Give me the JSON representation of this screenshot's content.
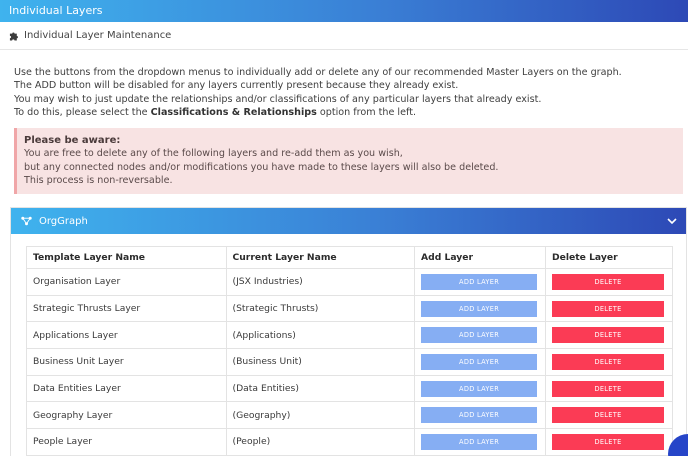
{
  "topbar": {
    "title": "Individual Layers"
  },
  "subheader": {
    "title": "Individual Layer Maintenance",
    "icon": "puzzle-icon"
  },
  "intro": {
    "line1": "Use the buttons from the dropdown menus to individually add or delete any of our recommended Master Layers on the graph.",
    "line2": "The ADD button will be disabled for any layers currently present because they already exist.",
    "line3": "You may wish to just update the relationships and/or classifications of any particular layers that already exist.",
    "line4_pre": "To do this, please select the ",
    "line4_bold": "Classifications & Relationships",
    "line4_post": " option from the left."
  },
  "alert": {
    "title": "Please be aware:",
    "line1": "You are free to delete any of the following layers and re-add them as you wish,",
    "line2": "but any connected nodes and/or modifications you have made to these layers will also be deleted.",
    "line3": "This process is non-reversable."
  },
  "card": {
    "title": "OrgGraph",
    "icon": "graph-icon",
    "toggle_icon": "chevron-down-icon"
  },
  "table": {
    "headers": [
      "Template Layer Name",
      "Current Layer Name",
      "Add Layer",
      "Delete Layer"
    ],
    "add_label": "ADD LAYER",
    "delete_label": "DELETE",
    "rows": [
      {
        "template": "Organisation Layer",
        "current": "(JSX Industries)"
      },
      {
        "template": "Strategic Thrusts Layer",
        "current": "(Strategic Thrusts)"
      },
      {
        "template": "Applications Layer",
        "current": "(Applications)"
      },
      {
        "template": "Business Unit Layer",
        "current": "(Business Unit)"
      },
      {
        "template": "Data Entities Layer",
        "current": "(Data Entities)"
      },
      {
        "template": "Geography Layer",
        "current": "(Geography)"
      },
      {
        "template": "People Layer",
        "current": "(People)"
      }
    ]
  },
  "colors": {
    "accent_start": "#3fb3ee",
    "accent_end": "#2d49b6",
    "add_button": "#86aef3",
    "delete_button": "#fb3b55",
    "alert_bg": "#f8e3e3"
  }
}
